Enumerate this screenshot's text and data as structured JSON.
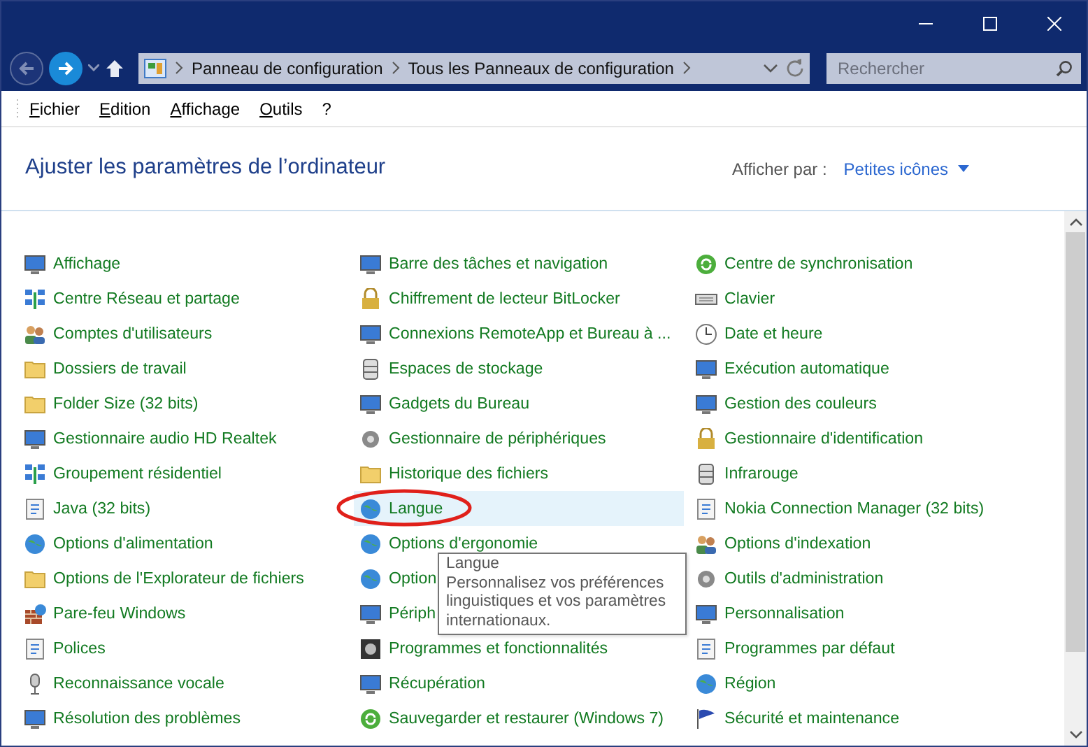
{
  "nav": {
    "back": {
      "disabled": true
    },
    "forward": {
      "disabled": false
    }
  },
  "address": {
    "breadcrumbs": [
      "Panneau de configuration",
      "Tous les Panneaux de configuration"
    ]
  },
  "search": {
    "placeholder": "Rechercher"
  },
  "menu": [
    "Fichier",
    "Edition",
    "Affichage",
    "Outils",
    "?"
  ],
  "heading": "Ajuster les paramètres de l’ordinateur",
  "view_by": {
    "label": "Afficher par :",
    "value": "Petites icônes"
  },
  "columns": [
    {
      "items": [
        {
          "label": "Affichage",
          "hovered": false,
          "circled": false
        },
        {
          "label": "Centre Réseau et partage",
          "hovered": false,
          "circled": false
        },
        {
          "label": "Comptes d'utilisateurs",
          "hovered": false,
          "circled": false
        },
        {
          "label": "Dossiers de travail",
          "hovered": false,
          "circled": false
        },
        {
          "label": "Folder Size (32 bits)",
          "hovered": false,
          "circled": false
        },
        {
          "label": "Gestionnaire audio HD Realtek",
          "hovered": false,
          "circled": false
        },
        {
          "label": "Groupement résidentiel",
          "hovered": false,
          "circled": false
        },
        {
          "label": "Java (32 bits)",
          "hovered": false,
          "circled": false
        },
        {
          "label": "Options d'alimentation",
          "hovered": false,
          "circled": false
        },
        {
          "label": "Options de l'Explorateur de fichiers",
          "hovered": false,
          "circled": false
        },
        {
          "label": "Pare-feu Windows",
          "hovered": false,
          "circled": false
        },
        {
          "label": "Polices",
          "hovered": false,
          "circled": false
        },
        {
          "label": "Reconnaissance vocale",
          "hovered": false,
          "circled": false
        },
        {
          "label": "Résolution des problèmes",
          "hovered": false,
          "circled": false
        }
      ]
    },
    {
      "items": [
        {
          "label": "Barre des tâches et navigation",
          "hovered": false,
          "circled": false
        },
        {
          "label": "Chiffrement de lecteur BitLocker",
          "hovered": false,
          "circled": false
        },
        {
          "label": "Connexions RemoteApp et Bureau à ...",
          "hovered": false,
          "circled": false
        },
        {
          "label": "Espaces de stockage",
          "hovered": false,
          "circled": false
        },
        {
          "label": "Gadgets du Bureau",
          "hovered": false,
          "circled": false
        },
        {
          "label": "Gestionnaire de périphériques",
          "hovered": false,
          "circled": false
        },
        {
          "label": "Historique des fichiers",
          "hovered": false,
          "circled": false
        },
        {
          "label": "Langue",
          "hovered": true,
          "circled": true
        },
        {
          "label": "Options d'ergonomie",
          "hovered": false,
          "circled": false
        },
        {
          "label": "Option",
          "hovered": false,
          "circled": false
        },
        {
          "label": "Périph",
          "hovered": false,
          "circled": false
        },
        {
          "label": "Programmes et fonctionnalités",
          "hovered": false,
          "circled": false
        },
        {
          "label": "Récupération",
          "hovered": false,
          "circled": false
        },
        {
          "label": "Sauvegarder et restaurer (Windows 7)",
          "hovered": false,
          "circled": false
        }
      ]
    },
    {
      "items": [
        {
          "label": "Centre de synchronisation",
          "hovered": false,
          "circled": false
        },
        {
          "label": "Clavier",
          "hovered": false,
          "circled": false
        },
        {
          "label": "Date et heure",
          "hovered": false,
          "circled": false
        },
        {
          "label": "Exécution automatique",
          "hovered": false,
          "circled": false
        },
        {
          "label": "Gestion des couleurs",
          "hovered": false,
          "circled": false
        },
        {
          "label": "Gestionnaire d'identification",
          "hovered": false,
          "circled": false
        },
        {
          "label": "Infrarouge",
          "hovered": false,
          "circled": false
        },
        {
          "label": "Nokia Connection Manager (32 bits)",
          "hovered": false,
          "circled": false
        },
        {
          "label": "Options d'indexation",
          "hovered": false,
          "circled": false
        },
        {
          "label": "Outils d'administration",
          "hovered": false,
          "circled": false
        },
        {
          "label": "Personnalisation",
          "hovered": false,
          "circled": false
        },
        {
          "label": "Programmes par défaut",
          "hovered": false,
          "circled": false
        },
        {
          "label": "Région",
          "hovered": false,
          "circled": false
        },
        {
          "label": "Sécurité et maintenance",
          "hovered": false,
          "circled": false
        }
      ]
    }
  ],
  "tooltip": {
    "title": "Langue",
    "text": "Personnalisez vos préférences linguistiques et vos paramètres internationaux."
  }
}
